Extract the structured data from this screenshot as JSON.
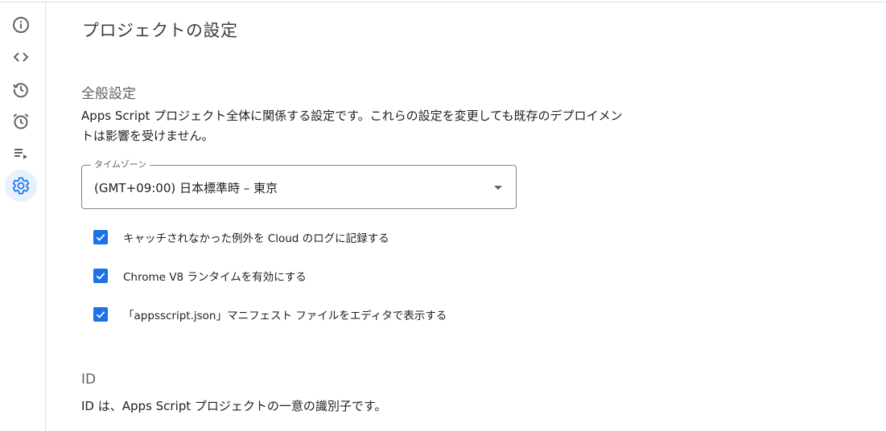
{
  "page": {
    "title": "プロジェクトの設定"
  },
  "sidebar": {
    "items": [
      {
        "icon": "info-icon",
        "active": false
      },
      {
        "icon": "code-icon",
        "active": false
      },
      {
        "icon": "history-icon",
        "active": false
      },
      {
        "icon": "alarm-icon",
        "active": false
      },
      {
        "icon": "playlist-play-icon",
        "active": false
      },
      {
        "icon": "gear-icon",
        "active": true
      }
    ]
  },
  "general": {
    "heading": "全般設定",
    "description_line1": "Apps Script プロジェクト全体に関係する設定です。これらの設定を変更しても既存のデプロイメン",
    "description_line2": "トは影響を受けません。",
    "timezone": {
      "label": "タイムゾーン",
      "value": "(GMT+09:00) 日本標準時 – 東京"
    },
    "checkboxes": [
      {
        "label": "キャッチされなかった例外を Cloud のログに記録する",
        "checked": true
      },
      {
        "label": "Chrome V8 ランタイムを有効にする",
        "checked": true
      },
      {
        "label": "「appsscript.json」マニフェスト ファイルをエディタで表示する",
        "checked": true
      }
    ]
  },
  "ids": {
    "heading": "ID",
    "description": "ID は、Apps Script プロジェクトの一意の識別子です。"
  },
  "colors": {
    "accent": "#1a73e8",
    "active_bg": "#e8f0fe",
    "icon_gray": "#5f6368"
  }
}
